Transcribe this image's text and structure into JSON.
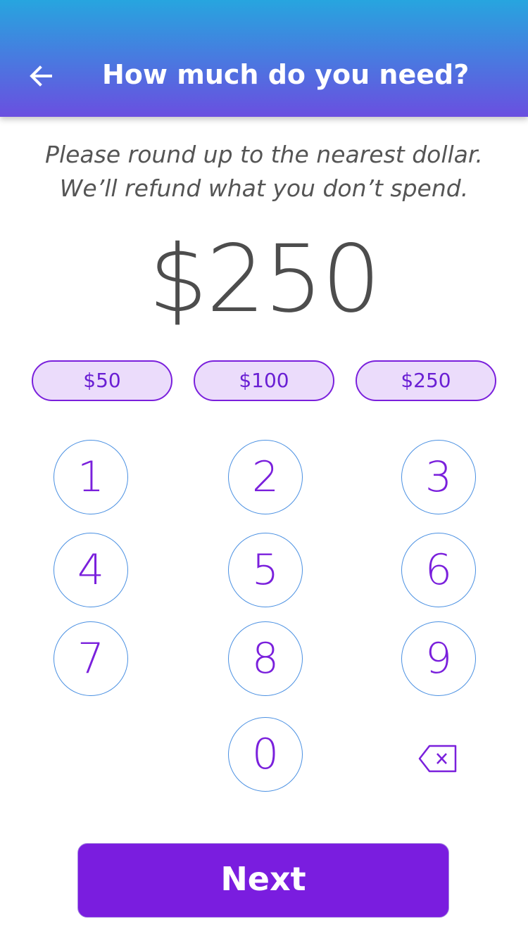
{
  "header": {
    "title": "How much do you need?",
    "back_icon": "arrow-left-icon"
  },
  "instructions": {
    "line1": "Please round up to the nearest dollar.",
    "line2": "We’ll refund what you don’t spend."
  },
  "amount": {
    "display": "$250"
  },
  "presets": [
    {
      "label": "$50"
    },
    {
      "label": "$100"
    },
    {
      "label": "$250"
    }
  ],
  "keypad": {
    "keys": [
      "1",
      "2",
      "3",
      "4",
      "5",
      "6",
      "7",
      "8",
      "9",
      "0"
    ],
    "backspace_icon": "backspace-icon"
  },
  "next_button": {
    "label": "Next"
  },
  "colors": {
    "header_gradient_top": "#27a5df",
    "header_gradient_bottom": "#6a4fe0",
    "accent_purple": "#7a1ddf",
    "preset_fill": "#ebdcfb",
    "key_border_blue": "#4a90e2"
  }
}
